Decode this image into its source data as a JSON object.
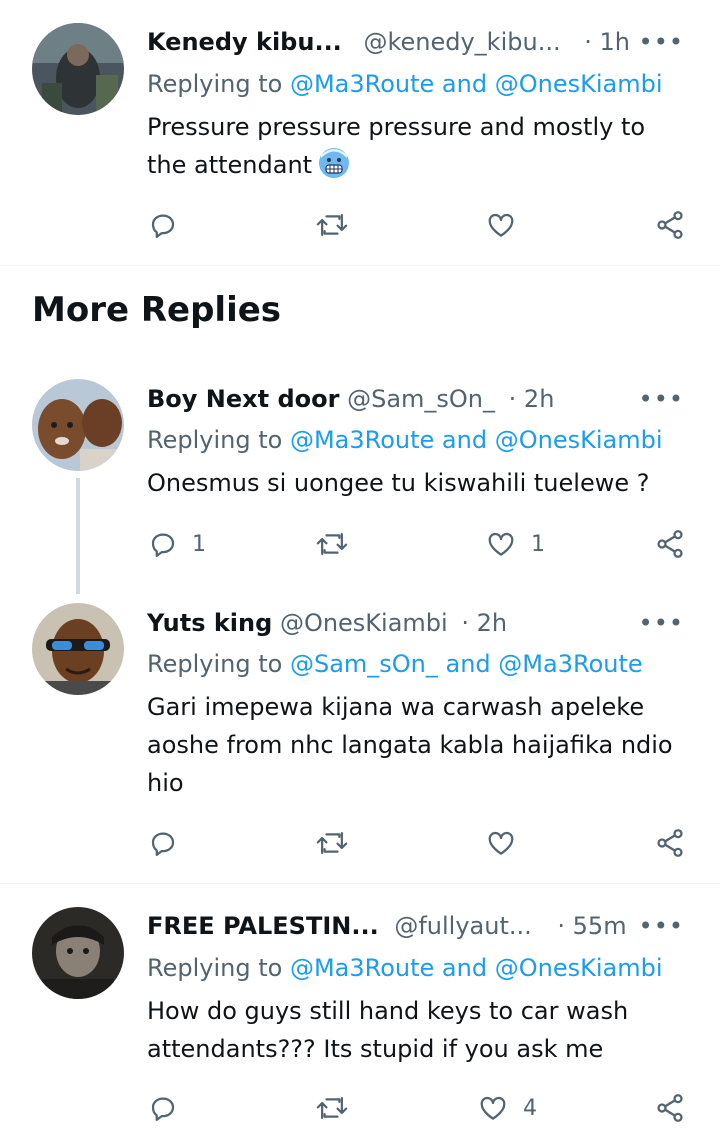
{
  "section_title": "More Replies",
  "tweets": [
    {
      "name": "Kenedy kibu...",
      "handle": "@kenedy_kibu...",
      "time": "· 1h",
      "reply_prefix": "Replying to",
      "reply_to": "@Ma3Route and @OnesKiambi",
      "body_lines": [
        "Pressure pressure pressure and mostly to",
        "the attendant"
      ],
      "emoji": "cold-face-emoji",
      "replies": "",
      "likes": ""
    },
    {
      "name": "Boy Next door",
      "handle": "@Sam_sOn_",
      "time": "· 2h",
      "reply_prefix": "Replying to",
      "reply_to": "@Ma3Route and @OnesKiambi",
      "body_lines": [
        "Onesmus si uongee tu kiswahili tuelewe ?"
      ],
      "replies": "1",
      "likes": "1"
    },
    {
      "name": "Yuts king",
      "handle": "@OnesKiambi",
      "time": "· 2h",
      "reply_prefix": "Replying to",
      "reply_to": "@Sam_sOn_ and @Ma3Route",
      "body_lines": [
        "Gari imepewa kijana wa carwash apeleke",
        "aoshe from nhc langata kabla haijafika ndio",
        "hio"
      ],
      "replies": "",
      "likes": ""
    },
    {
      "name": "FREE PALESTIN...",
      "handle": "@fullyaut...",
      "time": "· 55m",
      "reply_prefix": "Replying to",
      "reply_to": "@Ma3Route and @OnesKiambi",
      "body_lines": [
        "How do guys still hand keys to car wash",
        "attendants??? Its stupid if you ask me"
      ],
      "replies": "",
      "likes": "4"
    }
  ],
  "more_label": "•••",
  "colors": {
    "link": "#1d9bf0",
    "secondary": "#536471",
    "text": "#0f1419"
  }
}
